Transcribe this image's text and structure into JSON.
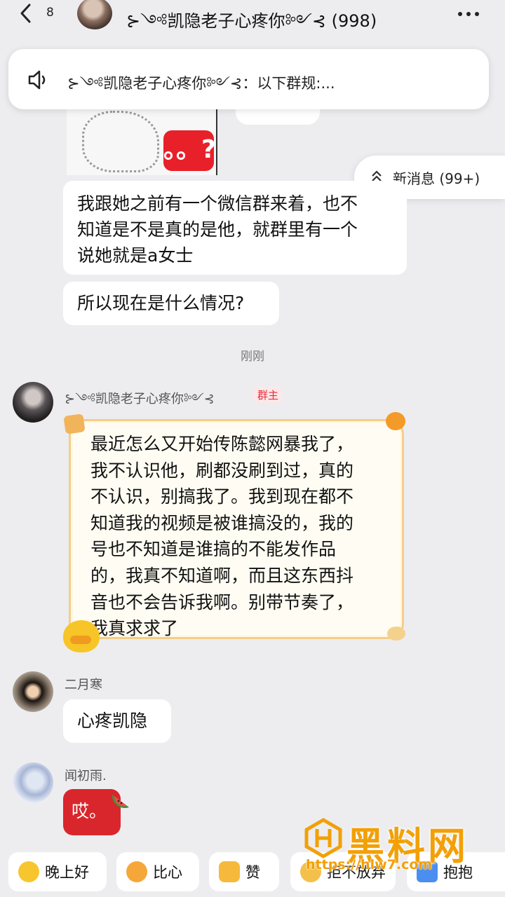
{
  "header": {
    "unread_count": "8",
    "title": "⊱༺凯隐老子心疼你༻⊰ (998)",
    "more_icon": "more-dots-icon",
    "back_icon": "back-chevron-icon"
  },
  "announcement": {
    "text": "⊱༺凯隐老子心疼你༻⊰：以下群规:..."
  },
  "sticker": {
    "badge_text": "。。?"
  },
  "new_messages": {
    "label": "新消息 (99+)"
  },
  "messages": {
    "m1_lines": [
      "我跟她之前有一个微信群来着，也不",
      "知道是不是真的是他，就群里有一个",
      "说她就是a女士"
    ],
    "m2": "所以现在是什么情况?",
    "time": "刚刚",
    "owner_name": "⊱༺凯隐老子心疼你༻⊰",
    "owner_badge": "群主",
    "owner_lines": [
      "最近怎么又开始传陈懿网暴我了，",
      "我不认识他，刷都没刷到过，真的",
      "不认识，别搞我了。我到现在都不",
      "知道我的视频是被谁搞没的，我的",
      "号也不知道是谁搞的不能发作品",
      "的，我真不知道啊，而且这东西抖",
      "音也不会告诉我啊。别带节奏了，",
      "我真求求了"
    ],
    "sender2": "二月寒",
    "m3": "心疼凯隐",
    "sender3": "闻初雨.",
    "m4": "哎。"
  },
  "quick_replies": [
    "晚上好",
    "比心",
    "赞",
    "拒不放弃",
    "抱抱"
  ],
  "watermark": {
    "brand": "黑料网",
    "url": "https://hlw7.com"
  },
  "colors": {
    "background": "#ededf0",
    "bubble": "#ffffff",
    "owner_badge": "#e0303a",
    "red_bubble": "#d9262c",
    "watermark": "#f2a007"
  }
}
